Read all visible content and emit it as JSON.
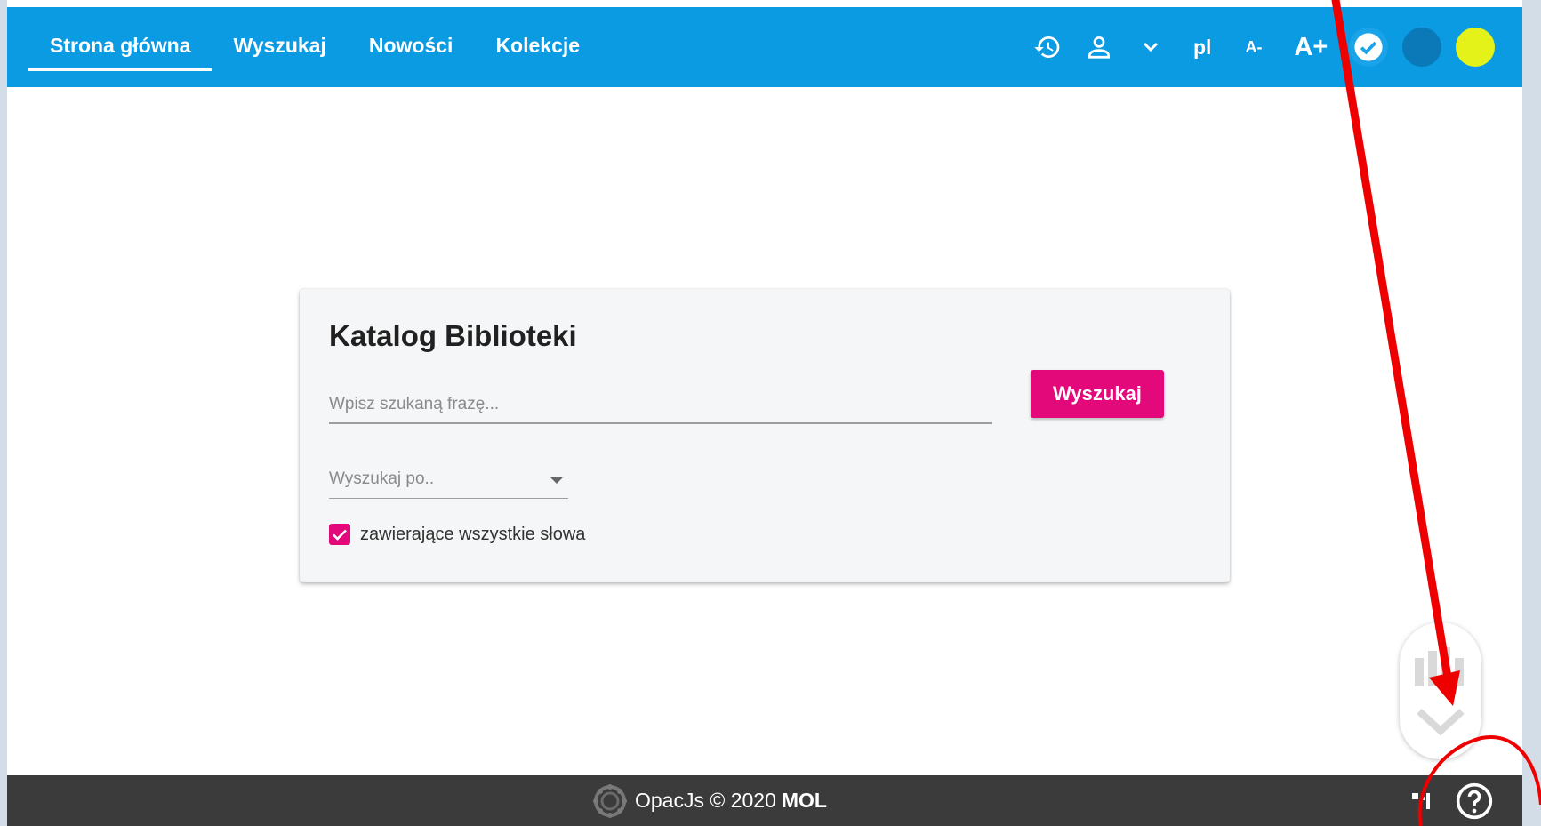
{
  "nav": {
    "tabs": [
      {
        "label": "Strona główna",
        "active": true
      },
      {
        "label": "Wyszukaj",
        "active": false
      },
      {
        "label": "Nowości",
        "active": false
      },
      {
        "label": "Kolekcje",
        "active": false
      }
    ]
  },
  "toolbar": {
    "history_icon": "history-icon",
    "user_icon": "user-icon",
    "dropdown_icon": "chevron-down-icon",
    "language": "pl",
    "font_decrease": "A-",
    "font_increase": "A+",
    "contrast_options": [
      "#1aa3e8",
      "#0b79b8",
      "#e5f21a"
    ]
  },
  "search": {
    "title": "Katalog Biblioteki",
    "placeholder": "Wpisz szukaną frazę...",
    "button_label": "Wyszukaj",
    "search_by_placeholder": "Wyszukaj po..",
    "all_words_label": "zawierające wszystkie słowa",
    "all_words_checked": true
  },
  "footer": {
    "text": "OpacJs © 2020",
    "brand": "MOL",
    "help_icon": "help-icon"
  },
  "colors": {
    "primary": "#0a9be3",
    "accent": "#e4097b",
    "footer_bg": "#3b3b3b",
    "annotation": "#ee0000"
  }
}
